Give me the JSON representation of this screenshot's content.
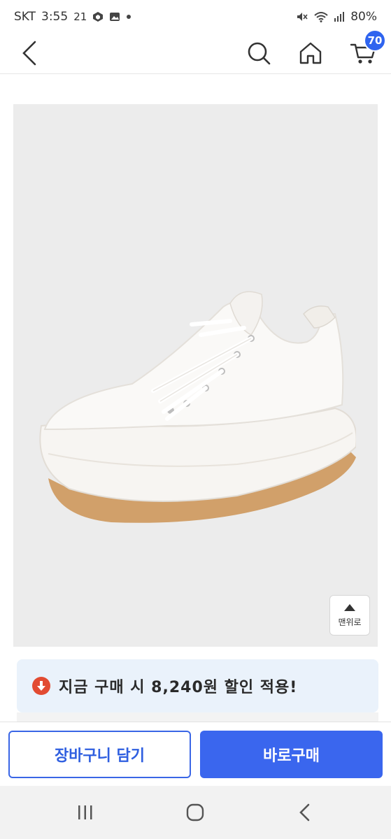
{
  "status_bar": {
    "carrier": "SKT",
    "time": "3:55",
    "temp": "21",
    "battery": "80%",
    "icons": [
      "cube-icon",
      "image-icon",
      "dot-icon",
      "mute-icon",
      "wifi-icon",
      "signal-icon"
    ]
  },
  "top_nav": {
    "icons": [
      "back-arrow-icon",
      "search-icon",
      "home-icon",
      "cart-icon"
    ],
    "cart_count": "70"
  },
  "product": {
    "image_bg": "#ececec",
    "scroll_top_label": "맨위로"
  },
  "discount": {
    "text": "지금 구매 시 8,240원 할인 적용!",
    "icon": "down-arrow-circle-icon",
    "icon_color": "#e24b32",
    "banner_color": "#eaf2fb"
  },
  "actions": {
    "add_to_cart": "장바구니 담기",
    "buy_now": "바로구매",
    "accent_color": "#3a66ee"
  },
  "system_nav": {
    "icons": [
      "recent-apps-icon",
      "home-circle-icon",
      "back-chevron-icon"
    ]
  }
}
